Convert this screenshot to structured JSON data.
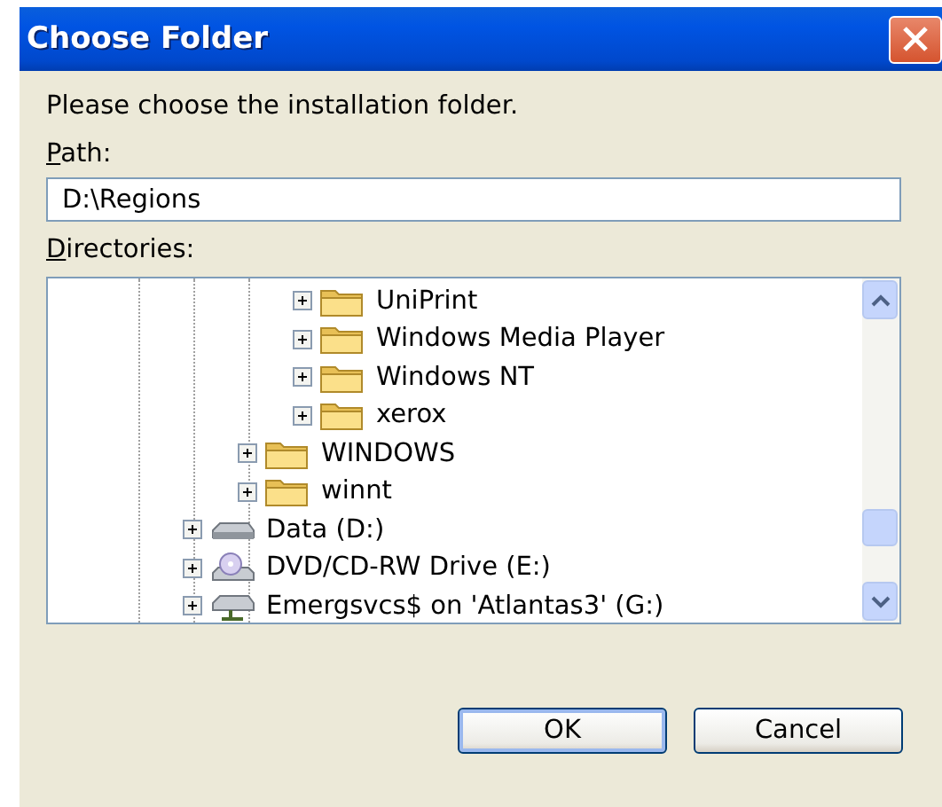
{
  "window": {
    "title": "Choose Folder"
  },
  "prompt": "Please choose the installation folder.",
  "path": {
    "label": "Path:",
    "value": "D:\\Regions"
  },
  "directories": {
    "label": "Directories:",
    "items": [
      {
        "children": [
          {
            "children": [
              {
                "label": "UniPrint",
                "kind": "folder",
                "expanded": false
              },
              {
                "label": "Windows Media Player",
                "kind": "folder",
                "expanded": false
              },
              {
                "label": "Windows NT",
                "kind": "folder",
                "expanded": false
              },
              {
                "label": "xerox",
                "kind": "folder",
                "expanded": false
              }
            ]
          },
          {
            "label": "WINDOWS",
            "kind": "folder",
            "expanded": false
          },
          {
            "label": "winnt",
            "kind": "folder",
            "expanded": false
          }
        ]
      },
      {
        "label": "Data (D:)",
        "kind": "drive",
        "expanded": false
      },
      {
        "label": "DVD/CD-RW Drive (E:)",
        "kind": "cddrive",
        "expanded": false
      },
      {
        "label": "Emergsvcs$ on 'Atlantas3' (G:)",
        "kind": "netdrive",
        "expanded": false
      }
    ]
  },
  "buttons": [
    "OK",
    "Cancel"
  ]
}
